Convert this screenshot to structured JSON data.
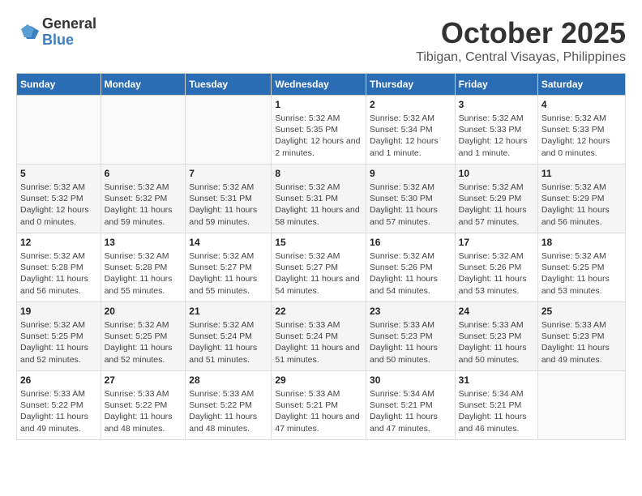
{
  "header": {
    "logo_general": "General",
    "logo_blue": "Blue",
    "month": "October 2025",
    "location": "Tibigan, Central Visayas, Philippines"
  },
  "days_of_week": [
    "Sunday",
    "Monday",
    "Tuesday",
    "Wednesday",
    "Thursday",
    "Friday",
    "Saturday"
  ],
  "weeks": [
    [
      {
        "day": "",
        "info": ""
      },
      {
        "day": "",
        "info": ""
      },
      {
        "day": "",
        "info": ""
      },
      {
        "day": "1",
        "info": "Sunrise: 5:32 AM\nSunset: 5:35 PM\nDaylight: 12 hours and 2 minutes."
      },
      {
        "day": "2",
        "info": "Sunrise: 5:32 AM\nSunset: 5:34 PM\nDaylight: 12 hours and 1 minute."
      },
      {
        "day": "3",
        "info": "Sunrise: 5:32 AM\nSunset: 5:33 PM\nDaylight: 12 hours and 1 minute."
      },
      {
        "day": "4",
        "info": "Sunrise: 5:32 AM\nSunset: 5:33 PM\nDaylight: 12 hours and 0 minutes."
      }
    ],
    [
      {
        "day": "5",
        "info": "Sunrise: 5:32 AM\nSunset: 5:32 PM\nDaylight: 12 hours and 0 minutes."
      },
      {
        "day": "6",
        "info": "Sunrise: 5:32 AM\nSunset: 5:32 PM\nDaylight: 11 hours and 59 minutes."
      },
      {
        "day": "7",
        "info": "Sunrise: 5:32 AM\nSunset: 5:31 PM\nDaylight: 11 hours and 59 minutes."
      },
      {
        "day": "8",
        "info": "Sunrise: 5:32 AM\nSunset: 5:31 PM\nDaylight: 11 hours and 58 minutes."
      },
      {
        "day": "9",
        "info": "Sunrise: 5:32 AM\nSunset: 5:30 PM\nDaylight: 11 hours and 57 minutes."
      },
      {
        "day": "10",
        "info": "Sunrise: 5:32 AM\nSunset: 5:29 PM\nDaylight: 11 hours and 57 minutes."
      },
      {
        "day": "11",
        "info": "Sunrise: 5:32 AM\nSunset: 5:29 PM\nDaylight: 11 hours and 56 minutes."
      }
    ],
    [
      {
        "day": "12",
        "info": "Sunrise: 5:32 AM\nSunset: 5:28 PM\nDaylight: 11 hours and 56 minutes."
      },
      {
        "day": "13",
        "info": "Sunrise: 5:32 AM\nSunset: 5:28 PM\nDaylight: 11 hours and 55 minutes."
      },
      {
        "day": "14",
        "info": "Sunrise: 5:32 AM\nSunset: 5:27 PM\nDaylight: 11 hours and 55 minutes."
      },
      {
        "day": "15",
        "info": "Sunrise: 5:32 AM\nSunset: 5:27 PM\nDaylight: 11 hours and 54 minutes."
      },
      {
        "day": "16",
        "info": "Sunrise: 5:32 AM\nSunset: 5:26 PM\nDaylight: 11 hours and 54 minutes."
      },
      {
        "day": "17",
        "info": "Sunrise: 5:32 AM\nSunset: 5:26 PM\nDaylight: 11 hours and 53 minutes."
      },
      {
        "day": "18",
        "info": "Sunrise: 5:32 AM\nSunset: 5:25 PM\nDaylight: 11 hours and 53 minutes."
      }
    ],
    [
      {
        "day": "19",
        "info": "Sunrise: 5:32 AM\nSunset: 5:25 PM\nDaylight: 11 hours and 52 minutes."
      },
      {
        "day": "20",
        "info": "Sunrise: 5:32 AM\nSunset: 5:25 PM\nDaylight: 11 hours and 52 minutes."
      },
      {
        "day": "21",
        "info": "Sunrise: 5:32 AM\nSunset: 5:24 PM\nDaylight: 11 hours and 51 minutes."
      },
      {
        "day": "22",
        "info": "Sunrise: 5:33 AM\nSunset: 5:24 PM\nDaylight: 11 hours and 51 minutes."
      },
      {
        "day": "23",
        "info": "Sunrise: 5:33 AM\nSunset: 5:23 PM\nDaylight: 11 hours and 50 minutes."
      },
      {
        "day": "24",
        "info": "Sunrise: 5:33 AM\nSunset: 5:23 PM\nDaylight: 11 hours and 50 minutes."
      },
      {
        "day": "25",
        "info": "Sunrise: 5:33 AM\nSunset: 5:23 PM\nDaylight: 11 hours and 49 minutes."
      }
    ],
    [
      {
        "day": "26",
        "info": "Sunrise: 5:33 AM\nSunset: 5:22 PM\nDaylight: 11 hours and 49 minutes."
      },
      {
        "day": "27",
        "info": "Sunrise: 5:33 AM\nSunset: 5:22 PM\nDaylight: 11 hours and 48 minutes."
      },
      {
        "day": "28",
        "info": "Sunrise: 5:33 AM\nSunset: 5:22 PM\nDaylight: 11 hours and 48 minutes."
      },
      {
        "day": "29",
        "info": "Sunrise: 5:33 AM\nSunset: 5:21 PM\nDaylight: 11 hours and 47 minutes."
      },
      {
        "day": "30",
        "info": "Sunrise: 5:34 AM\nSunset: 5:21 PM\nDaylight: 11 hours and 47 minutes."
      },
      {
        "day": "31",
        "info": "Sunrise: 5:34 AM\nSunset: 5:21 PM\nDaylight: 11 hours and 46 minutes."
      },
      {
        "day": "",
        "info": ""
      }
    ]
  ]
}
